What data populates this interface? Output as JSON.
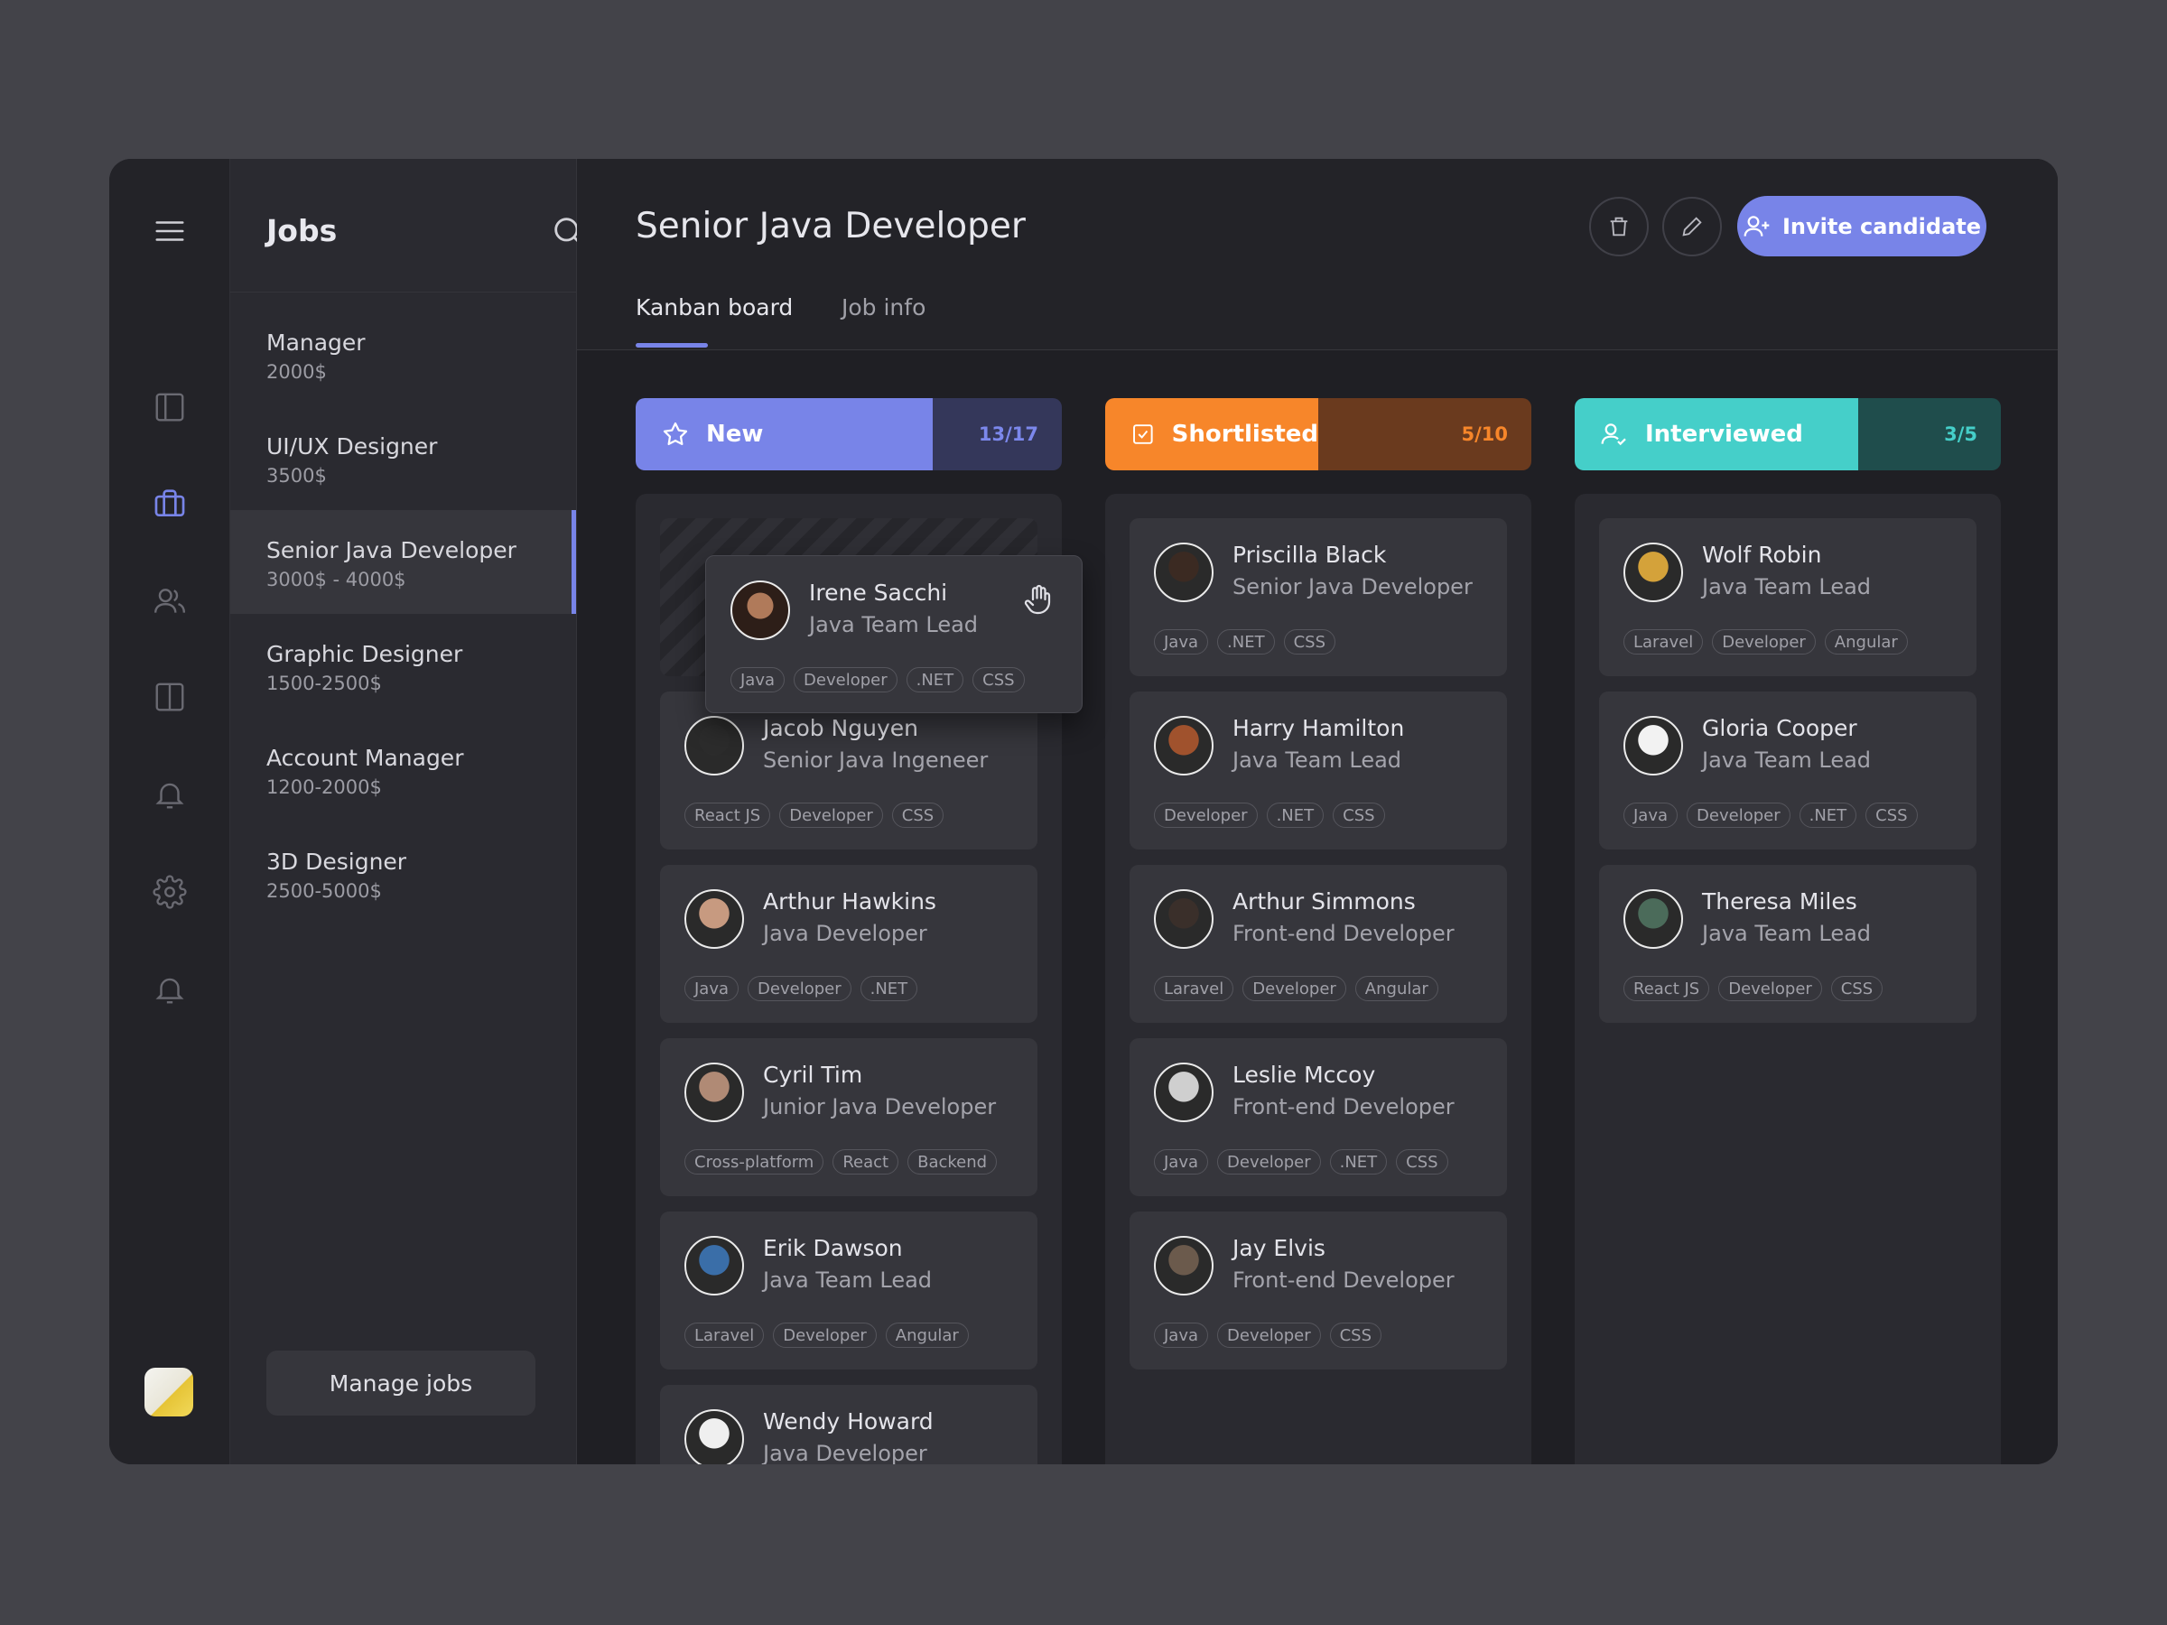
{
  "sidebar": {
    "icons": [
      "menu-icon",
      "panel-icon",
      "briefcase-icon",
      "users-icon",
      "columns-icon",
      "bell-icon",
      "gear-icon",
      "bell-icon"
    ]
  },
  "jobs_panel": {
    "title": "Jobs",
    "items": [
      {
        "name": "Manager",
        "salary": "2000$"
      },
      {
        "name": "UI/UX Designer",
        "salary": "3500$"
      },
      {
        "name": "Senior Java Developer",
        "salary": "3000$ - 4000$"
      },
      {
        "name": "Graphic Designer",
        "salary": "1500-2500$"
      },
      {
        "name": "Account Manager",
        "salary": "1200-2000$"
      },
      {
        "name": "3D Designer",
        "salary": "2500-5000$"
      }
    ],
    "manage_label": "Manage jobs"
  },
  "header": {
    "title": "Senior Java Developer",
    "invite_label": "Invite candidate",
    "tabs": [
      {
        "label": "Kanban board"
      },
      {
        "label": "Job info"
      }
    ]
  },
  "columns": [
    {
      "label": "New",
      "count": "13/17",
      "cards": [
        {
          "name": "Jacob Nguyen",
          "role": "Senior Java Ingeneer",
          "tags": [
            "React JS",
            "Developer",
            "CSS"
          ]
        },
        {
          "name": "Arthur Hawkins",
          "role": "Java Developer",
          "tags": [
            "Java",
            "Developer",
            ".NET"
          ]
        },
        {
          "name": "Cyril Tim",
          "role": "Junior Java Developer",
          "tags": [
            "Cross-platform",
            "React",
            "Backend"
          ]
        },
        {
          "name": "Erik Dawson",
          "role": "Java Team Lead",
          "tags": [
            "Laravel",
            "Developer",
            "Angular"
          ]
        },
        {
          "name": "Wendy Howard",
          "role": "Java Developer",
          "tags": []
        }
      ]
    },
    {
      "label": "Shortlisted",
      "count": "5/10",
      "cards": [
        {
          "name": "Priscilla Black",
          "role": "Senior Java Developer",
          "tags": [
            "Java",
            ".NET",
            "CSS"
          ]
        },
        {
          "name": "Harry Hamilton",
          "role": "Java Team Lead",
          "tags": [
            "Developer",
            ".NET",
            "CSS"
          ]
        },
        {
          "name": "Arthur Simmons",
          "role": "Front-end Developer",
          "tags": [
            "Laravel",
            "Developer",
            "Angular"
          ]
        },
        {
          "name": "Leslie Mccoy",
          "role": "Front-end Developer",
          "tags": [
            "Java",
            "Developer",
            ".NET",
            "CSS"
          ]
        },
        {
          "name": "Jay Elvis",
          "role": "Front-end Developer",
          "tags": [
            "Java",
            "Developer",
            "CSS"
          ]
        }
      ]
    },
    {
      "label": "Interviewed",
      "count": "3/5",
      "cards": [
        {
          "name": "Wolf Robin",
          "role": "Java Team Lead",
          "tags": [
            "Laravel",
            "Developer",
            "Angular"
          ]
        },
        {
          "name": "Gloria Cooper",
          "role": "Java Team Lead",
          "tags": [
            "Java",
            "Developer",
            ".NET",
            "CSS"
          ]
        },
        {
          "name": "Theresa Miles",
          "role": "Java Team Lead",
          "tags": [
            "React JS",
            "Developer",
            "CSS"
          ]
        }
      ]
    }
  ],
  "dragging": {
    "name": "Irene Sacchi",
    "role": "Java Team Lead",
    "tags": [
      "Java",
      "Developer",
      ".NET",
      "CSS"
    ]
  },
  "colors": {
    "accent": "#7884e8",
    "new": "#7884e8",
    "shortlisted": "#f7862a",
    "interviewed": "#45cfc9"
  }
}
